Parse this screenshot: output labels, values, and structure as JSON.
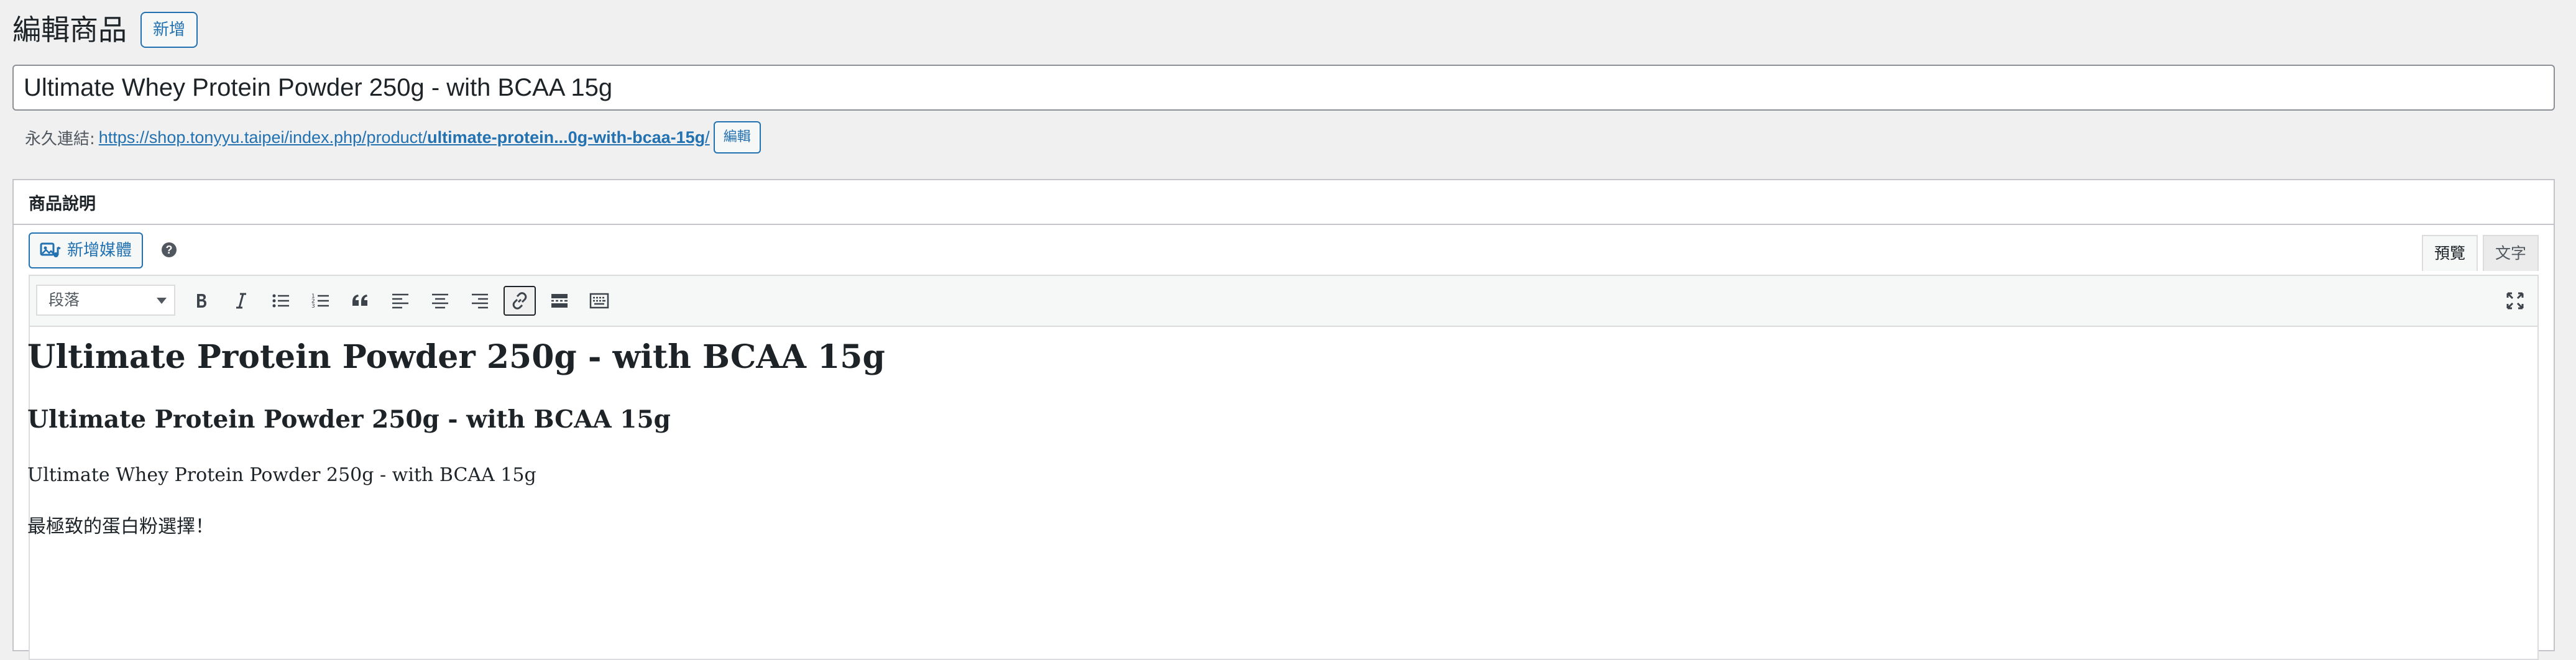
{
  "header": {
    "title": "編輯商品",
    "add_new_label": "新增"
  },
  "product": {
    "title": "Ultimate Whey Protein Powder 250g - with BCAA 15g"
  },
  "permalink": {
    "label": "永久連結:",
    "url_base": "https://shop.tonyyu.taipei/index.php/product/",
    "url_slug": "ultimate-protein...0g-with-bcaa-15g",
    "url_trailing": "/",
    "edit_label": "編輯"
  },
  "description_box": {
    "title": "商品說明",
    "add_media_label": "新增媒體",
    "help_icon": "?",
    "tabs": [
      {
        "label": "預覽",
        "active": true
      },
      {
        "label": "文字",
        "active": false
      }
    ]
  },
  "toolbar": {
    "format_select_value": "段落",
    "buttons": [
      "bold-icon",
      "italic-icon",
      "bulleted-list-icon",
      "numbered-list-icon",
      "blockquote-icon",
      "align-left-icon",
      "align-center-icon",
      "align-right-icon",
      "insert-link-icon",
      "read-more-icon",
      "toolbar-toggle-icon",
      "fullscreen-icon"
    ],
    "pressed_button": "insert-link-icon"
  },
  "content": {
    "heading1": "Ultimate Protein Powder 250g - with BCAA 15g",
    "heading2": "Ultimate Protein Powder 250g - with BCAA 15g",
    "paragraph1": "Ultimate Whey Protein Powder 250g - with BCAA 15g",
    "paragraph2": "最極致的蛋白粉選擇！"
  },
  "colors": {
    "accent": "#2271b1",
    "background": "#f0f0f1",
    "text": "#1d2327"
  }
}
